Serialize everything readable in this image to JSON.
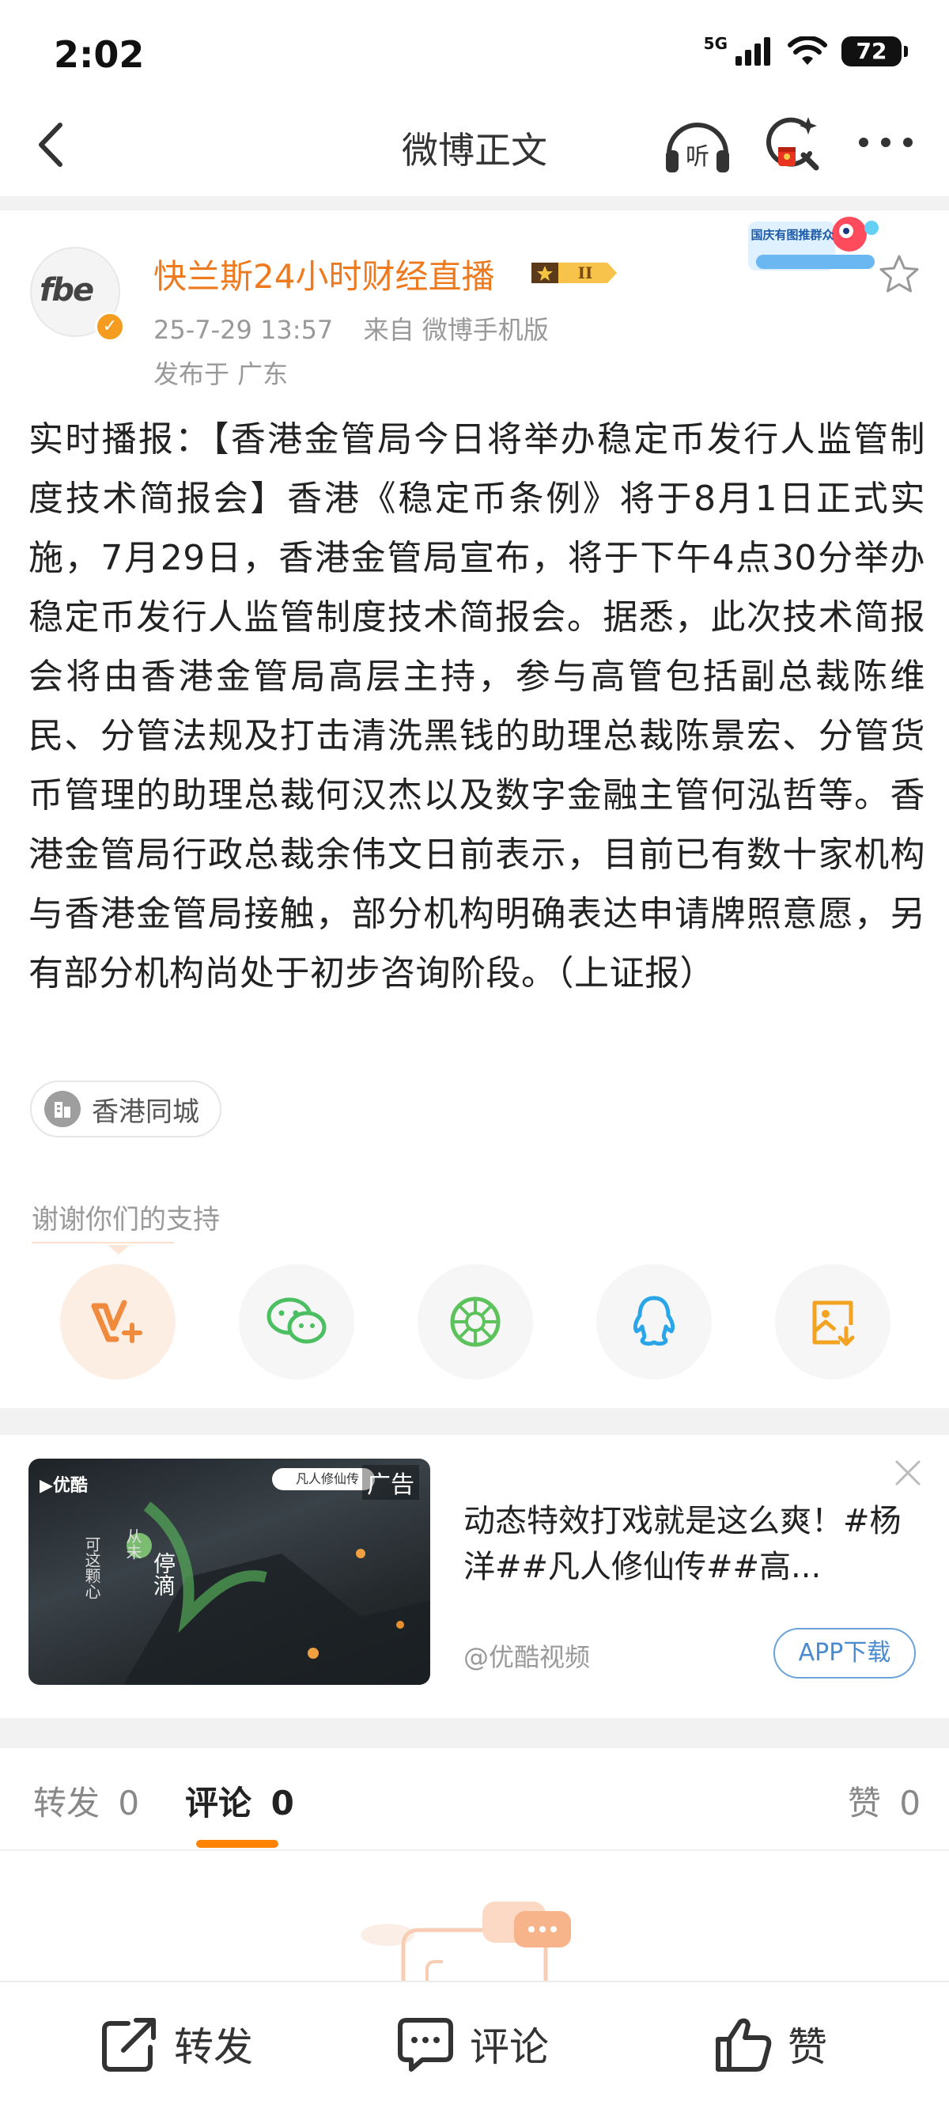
{
  "status_bar": {
    "time": "2:02",
    "network": "5G",
    "battery": "72"
  },
  "nav": {
    "title": "微博正文",
    "listen_label": "听"
  },
  "post": {
    "author": "快兰斯24小时财经直播",
    "avatar_text": "fbe",
    "vip_level": "II",
    "timestamp": "25-7-29 13:57",
    "source": "来自 微博手机版",
    "location": "发布于 广东",
    "promo_sticker": "国庆有图推群众",
    "body": "实时播报：【香港金管局今日将举办稳定币发行人监管制度技术简报会】香港《稳定币条例》将于8月1日正式实施，7月29日，香港金管局宣布，将于下午4点30分举办稳定币发行人监管制度技术简报会。据悉，此次技术简报会将由香港金管局高层主持，参与高管包括副总裁陈维民、分管法规及打击清洗黑钱的助理总裁陈景宏、分管货币管理的助理总裁何汉杰以及数字金融主管何泓哲等。香港金管局行政总裁余伟文日前表示，目前已有数十家机构与香港金管局接触，部分机构明确表达申请牌照意愿，另有部分机构尚处于初步咨询阶段。（上证报）",
    "topic": "香港同城",
    "support_text": "谢谢你们的支持"
  },
  "share_buttons": [
    {
      "name": "vplus-icon",
      "color": "#f08a3c"
    },
    {
      "name": "wechat-icon",
      "color": "#4cbf62"
    },
    {
      "name": "moments-icon",
      "color": "#5cc25b"
    },
    {
      "name": "qq-icon",
      "color": "#2aa6e8"
    },
    {
      "name": "save-image-icon",
      "color": "#f2a321"
    }
  ],
  "ad": {
    "brand": "优酷",
    "search_chip": "凡人修仙传",
    "tag": "广告",
    "poem_col1": "可这颗心",
    "poem_col2": "从未",
    "poem_col3": "停滴",
    "title": "动态特效打戏就是这么爽！#杨洋##凡人修仙传##高...",
    "source": "@优酷视频",
    "download_label": "APP下载"
  },
  "tabs": {
    "repost_label": "转发",
    "repost_count": "0",
    "comment_label": "评论",
    "comment_count": "0",
    "like_label": "赞",
    "like_count": "0"
  },
  "bottom_bar": {
    "repost": "转发",
    "comment": "评论",
    "like": "赞"
  },
  "colors": {
    "accent": "#ff8200",
    "author": "#ee7a1f",
    "link_blue": "#4a8bd0"
  }
}
